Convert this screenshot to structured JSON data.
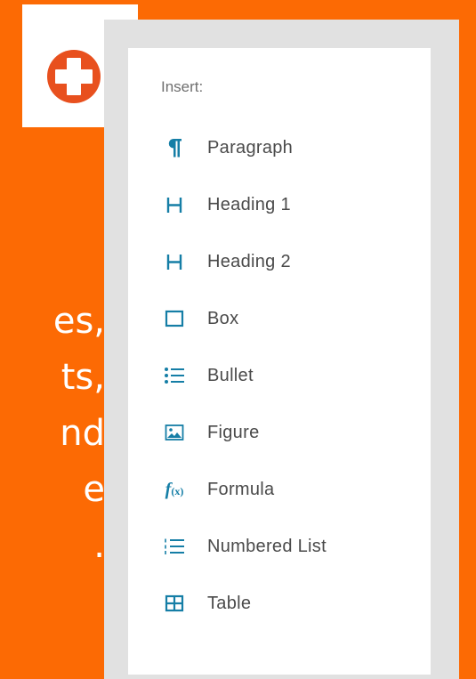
{
  "side_text": {
    "lines": [
      "es,",
      "ts,",
      "nd",
      "e",
      "."
    ]
  },
  "add_button": {
    "icon": "plus-circle-icon",
    "color": "#e8501e"
  },
  "menu": {
    "header": "Insert:",
    "icon_color": "#157ea6",
    "items": [
      {
        "label": "Paragraph",
        "icon": "paragraph-icon"
      },
      {
        "label": "Heading 1",
        "icon": "heading-icon"
      },
      {
        "label": "Heading 2",
        "icon": "heading-icon"
      },
      {
        "label": "Box",
        "icon": "box-icon"
      },
      {
        "label": "Bullet",
        "icon": "bullet-list-icon"
      },
      {
        "label": "Figure",
        "icon": "figure-icon"
      },
      {
        "label": "Formula",
        "icon": "formula-icon"
      },
      {
        "label": "Numbered List",
        "icon": "numbered-list-icon"
      },
      {
        "label": "Table",
        "icon": "table-icon"
      }
    ]
  },
  "colors": {
    "background": "#fc6a04",
    "panel": "#e1e1e1",
    "menu_bg": "#ffffff"
  }
}
